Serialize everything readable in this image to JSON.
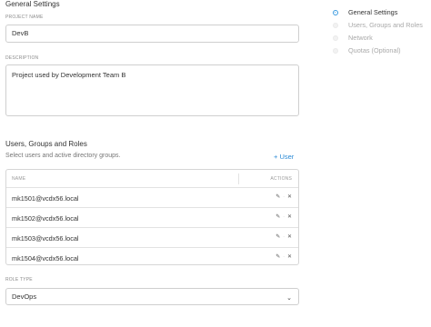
{
  "general": {
    "title": "General Settings",
    "project_name_label": "PROJECT NAME",
    "project_name_value": "DevB",
    "description_label": "DESCRIPTION",
    "description_value": "Project used by Development Team B"
  },
  "users": {
    "title": "Users, Groups and Roles",
    "hint": "Select users and active directory groups.",
    "add_label": "+ User",
    "columns": {
      "name": "NAME",
      "actions": "ACTIONS"
    },
    "rows": [
      {
        "name": "mk1501@vcdx56.local"
      },
      {
        "name": "mk1502@vcdx56.local"
      },
      {
        "name": "mk1503@vcdx56.local"
      },
      {
        "name": "mk1504@vcdx56.local"
      }
    ],
    "edit_glyph": "✎",
    "remove_glyph": "✕",
    "sep_glyph": "·"
  },
  "role": {
    "label": "ROLE TYPE",
    "value": "DevOps",
    "arrow_glyph": "⌄"
  },
  "wizard": {
    "steps": [
      {
        "label": "General Settings",
        "state": "active"
      },
      {
        "label": "Users, Groups and Roles",
        "state": "inactive"
      },
      {
        "label": "Network",
        "state": "inactive"
      },
      {
        "label": "Quotas (Optional)",
        "state": "inactive"
      }
    ]
  },
  "colors": {
    "accent": "#2a8ad6",
    "border": "#cfcfcf",
    "muted": "#a9a9a9"
  },
  "icons": {
    "edit": "pencil-icon",
    "remove": "close-icon",
    "select": "chevron-down-icon"
  }
}
